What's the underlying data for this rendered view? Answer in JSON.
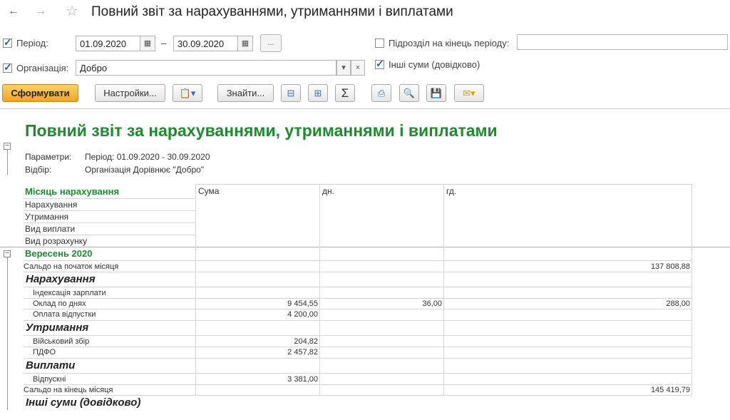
{
  "window": {
    "title": "Повний звіт за нарахуваннями, утриманнями і виплатами",
    "back_icon": "arrow-left-icon",
    "forward_icon": "arrow-right-icon",
    "favorite_icon": "star-icon"
  },
  "form": {
    "period_label": "Період:",
    "period_from": "01.09.2020",
    "period_dash": "–",
    "period_to": "30.09.2020",
    "period_more": "...",
    "org_label": "Організація:",
    "org_value": "Добро",
    "subdiv_label": "Підрозділ на кінець періоду:",
    "subdiv_value": "",
    "other_sums_label": "Інші суми (довідково)",
    "period_checked": true,
    "org_checked": true,
    "subdiv_checked": false,
    "other_sums_checked": true
  },
  "toolbar": {
    "generate_label": "Сформувати",
    "settings_label": "Настройки...",
    "find_label": "Знайти...",
    "sum_symbol": "Σ"
  },
  "report": {
    "title": "Повний звіт за нарахуваннями, утриманнями і виплатами",
    "params_label": "Параметри:",
    "params_value": "Період: 01.09.2020 - 30.09.2020",
    "filter_label": "Відбір:",
    "filter_value": "Організація Дорівнює \"Добро\"",
    "header": {
      "month": "Місяць нарахування",
      "rows": [
        "Нарахування",
        "Утримання",
        "Вид виплати",
        "Вид розрахунку"
      ],
      "col_sum": "Сума",
      "col_days": "дн.",
      "col_hours": "гд."
    },
    "month": "Вересень 2020",
    "opening_balance_label": "Сальдо на початок місяця",
    "opening_balance_value": "137 808,88",
    "accruals_title": "Нарахування",
    "accruals": [
      {
        "name": "Індексація зарплати",
        "sum": "",
        "days": "",
        "hours": ""
      },
      {
        "name": "Оклад по днях",
        "sum": "9 454,55",
        "days": "36,00",
        "hours": "288,00"
      },
      {
        "name": "Оплата відпустки",
        "sum": "4 200,00",
        "days": "",
        "hours": ""
      }
    ],
    "deductions_title": "Утримання",
    "deductions": [
      {
        "name": "Військовий збір",
        "sum": "204,82"
      },
      {
        "name": "ПДФО",
        "sum": "2 457,82"
      }
    ],
    "payments_title": "Виплати",
    "payments": [
      {
        "name": "Відпускні",
        "sum": "3 381,00"
      }
    ],
    "closing_balance_label": "Сальдо на кінець місяця",
    "closing_balance_value": "145 419,79",
    "other_sums_title": "Інші суми (довідково)"
  }
}
